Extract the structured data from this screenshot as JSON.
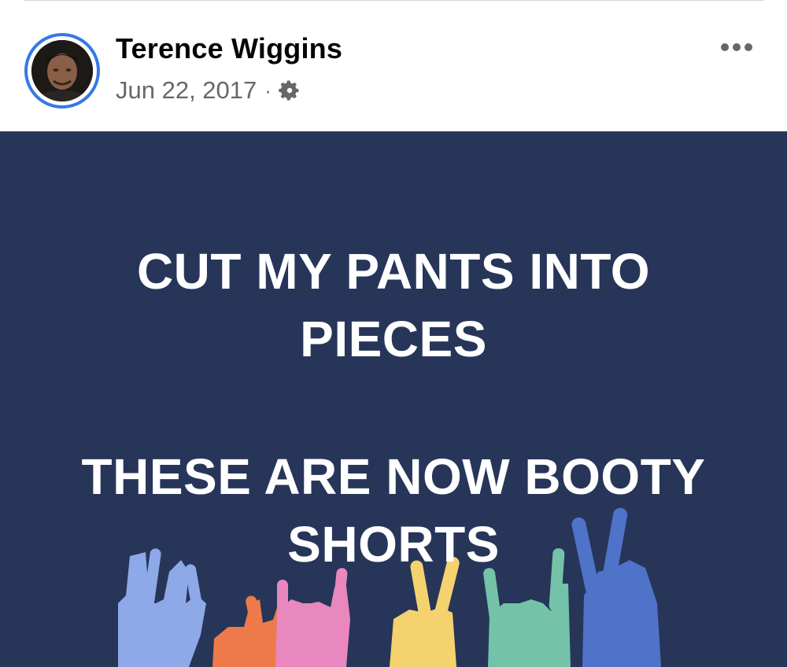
{
  "post": {
    "author": "Terence Wiggins",
    "date": "Jun 22, 2017",
    "separator": "·",
    "privacy_icon": "gear-icon",
    "more_icon": "more-options-icon"
  },
  "image": {
    "background_color": "#273559",
    "text_line_1": "CUT MY PANTS INTO PIECES",
    "text_line_2": "THESE ARE NOW BOOTY SHORTS",
    "hand_colors": [
      "#8ea9e8",
      "#ee7a4a",
      "#e987bf",
      "#f4d26e",
      "#74c2a8",
      "#4e73c8"
    ]
  },
  "colors": {
    "avatar_ring": "#3578e5",
    "author_text": "#050505",
    "meta_text": "#65676b"
  }
}
